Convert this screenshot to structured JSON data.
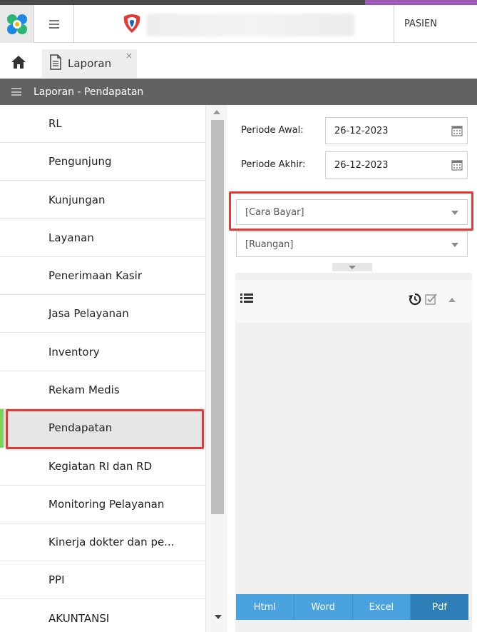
{
  "header": {
    "pasien_label": "PASIEN"
  },
  "tabs": {
    "report_label": "Laporan",
    "close_glyph": "×"
  },
  "section": {
    "title": "Laporan - Pendapatan"
  },
  "sidebar": {
    "active_item": "Pendapatan",
    "items": [
      {
        "label": "RL"
      },
      {
        "label": "Pengunjung"
      },
      {
        "label": "Kunjungan"
      },
      {
        "label": "Layanan"
      },
      {
        "label": "Penerimaan Kasir"
      },
      {
        "label": "Jasa Pelayanan"
      },
      {
        "label": "Inventory"
      },
      {
        "label": "Rekam Medis"
      },
      {
        "label": "Pendapatan"
      },
      {
        "label": "Kegiatan RI dan RD"
      },
      {
        "label": "Monitoring Pelayanan"
      },
      {
        "label": "Kinerja dokter dan pe..."
      },
      {
        "label": "PPI"
      },
      {
        "label": "AKUNTANSI"
      }
    ]
  },
  "filters": {
    "periode_awal_label": "Periode Awal:",
    "periode_awal_value": "26-12-2023",
    "periode_akhir_label": "Periode Akhir:",
    "periode_akhir_value": "26-12-2023",
    "cara_bayar_placeholder": "[Cara Bayar]",
    "ruangan_placeholder": "[Ruangan]"
  },
  "export": {
    "html_label": "Html",
    "word_label": "Word",
    "excel_label": "Excel",
    "pdf_label": "Pdf"
  },
  "colors": {
    "highlight": "#e53935",
    "active_marker": "#7dd35a",
    "export_button": "#4aa3df",
    "export_pdf": "#2f7fb8",
    "section_header": "#626262"
  },
  "icons": {
    "app_logo": "app-logo-icon",
    "menu": "hamburger-icon",
    "home": "home-icon",
    "document": "document-icon",
    "calendar": "calendar-icon",
    "list": "list-icon",
    "reset": "reset-icon",
    "check": "check-icon"
  }
}
